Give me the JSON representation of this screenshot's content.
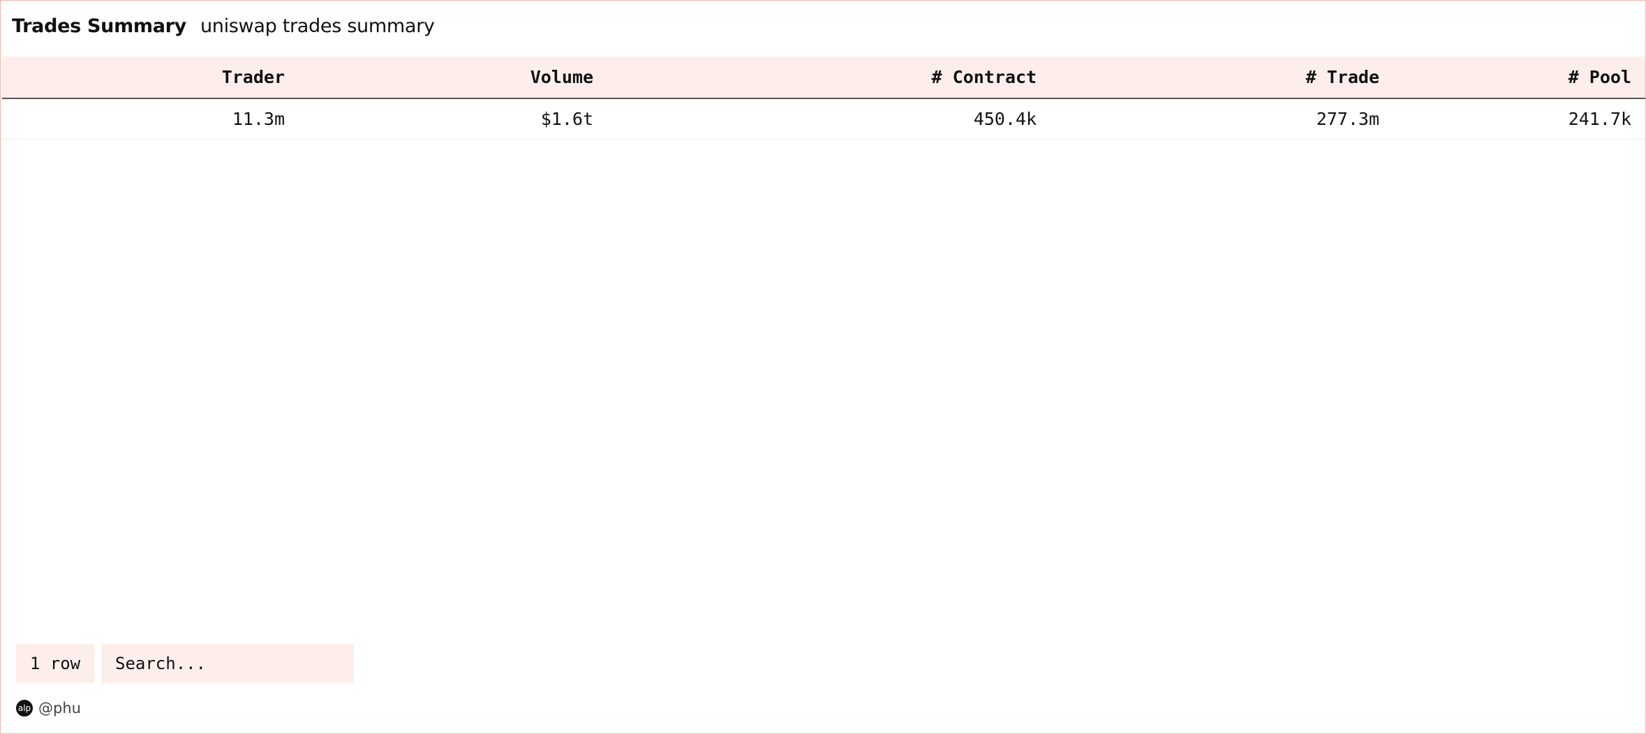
{
  "header": {
    "title": "Trades Summary",
    "subtitle": "uniswap trades summary"
  },
  "table": {
    "columns": [
      "Trader",
      "Volume",
      "# Contract",
      "# Trade",
      "# Pool"
    ],
    "rows": [
      [
        "11.3m",
        "$1.6t",
        "450.4k",
        "277.3m",
        "241.7k"
      ]
    ]
  },
  "footer": {
    "row_count": "1 row",
    "search_placeholder": "Search...",
    "author_avatar": "alp",
    "author_handle": "@phu"
  },
  "colors": {
    "border": "#f2b3ae",
    "header_bg": "#fdeeeb",
    "text": "#111111"
  }
}
